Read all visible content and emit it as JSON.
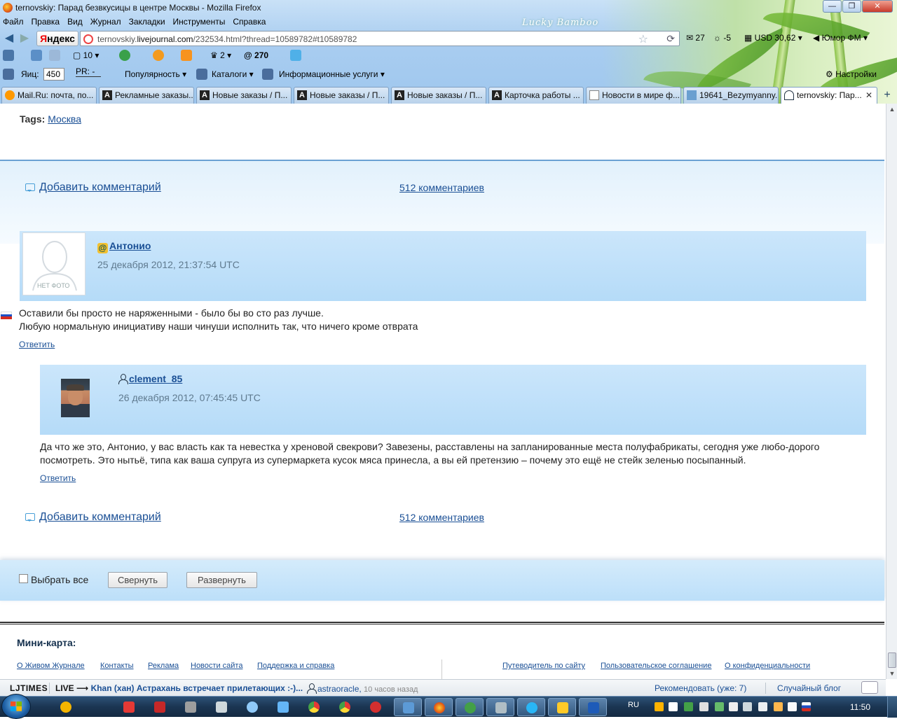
{
  "window": {
    "title": "ternovskiy: Парад безвкусицы в центре Москвы - Mozilla Firefox",
    "theme_name": "Lucky Bamboo",
    "buttons": {
      "minimize": "—",
      "maximize": "❐",
      "close": "✕"
    }
  },
  "menu": [
    "Файл",
    "Правка",
    "Вид",
    "Журнал",
    "Закладки",
    "Инструменты",
    "Справка"
  ],
  "navbar": {
    "yandex_label_red": "Я",
    "yandex_label_rest": "ндекс",
    "url_prefix": "ternovskiy.",
    "url_domain": "livejournal.com",
    "url_rest": "/232534.html?thread=10589782#t10589782",
    "mail_count": "27",
    "weather": "-5",
    "currency": "USD 30,62",
    "radio": "Юмор ФМ"
  },
  "toolbar2": {
    "counter_10": "10",
    "counter_2": "2",
    "counter_270": "@ 270"
  },
  "toolbar3": {
    "tic_label": "Яиц:",
    "tic_value": "450",
    "pr_label": "PR: -",
    "popularity": "Популярность",
    "catalogs": "Каталоги",
    "info_services": "Информационные услуги",
    "settings": "Настройки"
  },
  "tabs": [
    {
      "label": "Mail.Ru: почта, по...",
      "icon": "mail-icon"
    },
    {
      "label": "Рекламные заказы...",
      "icon": "letter-a-icon"
    },
    {
      "label": "Новые заказы / П...",
      "icon": "letter-a-icon"
    },
    {
      "label": "Новые заказы / П...",
      "icon": "letter-a-icon"
    },
    {
      "label": "Новые заказы / П...",
      "icon": "letter-a-icon"
    },
    {
      "label": "Карточка работы ...",
      "icon": "letter-a-icon"
    },
    {
      "label": "Новости в мире ф...",
      "icon": "blank-page-icon"
    },
    {
      "label": "19641_Bezymyanny...",
      "icon": "image-icon"
    },
    {
      "label": "ternovskiy: Пар...",
      "icon": "lj-user-icon",
      "active": true
    }
  ],
  "post": {
    "tags_label": "Tags:",
    "tag": "Москва",
    "add_comment": "Добавить комментарий",
    "comment_count": "512 комментариев"
  },
  "comments": [
    {
      "user": "Антонио",
      "avatar_caption": "НЕТ ФОТО",
      "date": "25 декабря 2012, 21:37:54 UTC",
      "text_line1": "Оставили бы просто не наряженными - было бы во сто раз лучше.",
      "text_line2": "Любую нормальную инициативу наши чинуши исполнить так, что ничего кроме отврата",
      "reply": "Ответить"
    },
    {
      "user": "clement_85",
      "date": "26 декабря 2012, 07:45:45 UTC",
      "text_line1": "Да что же это, Антонио, у вас власть как та невестка у хреновой свекрови? Завезены, расставлены на запланированные места полуфабрикаты, сегодня уже любо-дорого",
      "text_line2": "посмотреть. Это нытьё, типа как ваша супруга из супермаркета кусок мяса принесла, а вы ей претензию – почему это ещё не стейк зеленью посыпанный.",
      "reply": "Ответить"
    }
  ],
  "controls": {
    "select_all": "Выбрать все",
    "collapse": "Свернуть",
    "expand": "Развернуть"
  },
  "footer": {
    "minimap": "Мини-карта:",
    "links_left": [
      "О Живом Журнале",
      "Контакты",
      "Реклама",
      "Новости сайта",
      "Поддержка и справка"
    ],
    "links_right": [
      "Путеводитель по сайту",
      "Пользовательское соглашение",
      "О конфиденциальности"
    ]
  },
  "ljbar": {
    "logo": "LJTIMES",
    "live_label": "LIVE ⟶",
    "headline": "Khan (хан) Астрахань встречает прилетающих :-)...",
    "user": "astraoracle",
    "ago": "10 часов назад",
    "recommend": "Рекомендовать (уже: 7)",
    "random": "Случайный блог"
  },
  "taskbar": {
    "lang": "RU",
    "clock": "11:50"
  },
  "colors": {
    "link": "#1a4f95",
    "comment_header": "#b5dbf8",
    "band": "#e2f1fc",
    "taskbar": "#1b3552"
  }
}
